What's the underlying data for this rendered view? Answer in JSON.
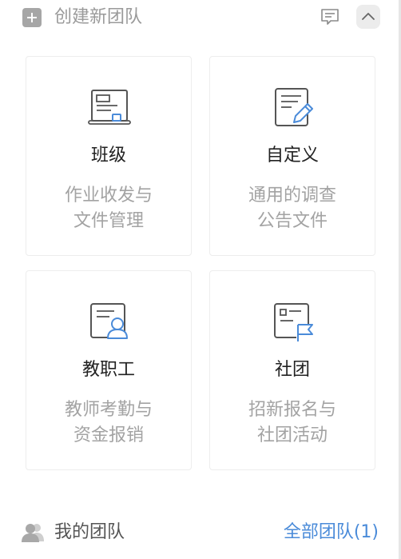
{
  "header": {
    "create_title": "创建新团队"
  },
  "cards": [
    {
      "title": "班级",
      "desc_line1": "作业收发与",
      "desc_line2": "文件管理"
    },
    {
      "title": "自定义",
      "desc_line1": "通用的调查",
      "desc_line2": "公告文件"
    },
    {
      "title": "教职工",
      "desc_line1": "教师考勤与",
      "desc_line2": "资金报销"
    },
    {
      "title": "社团",
      "desc_line1": "招新报名与",
      "desc_line2": "社团活动"
    }
  ],
  "footer": {
    "my_teams_label": "我的团队",
    "all_teams_label": "全部团队(1)"
  },
  "colors": {
    "icon_gray": "#666666",
    "accent_blue": "#4a8bd9"
  }
}
